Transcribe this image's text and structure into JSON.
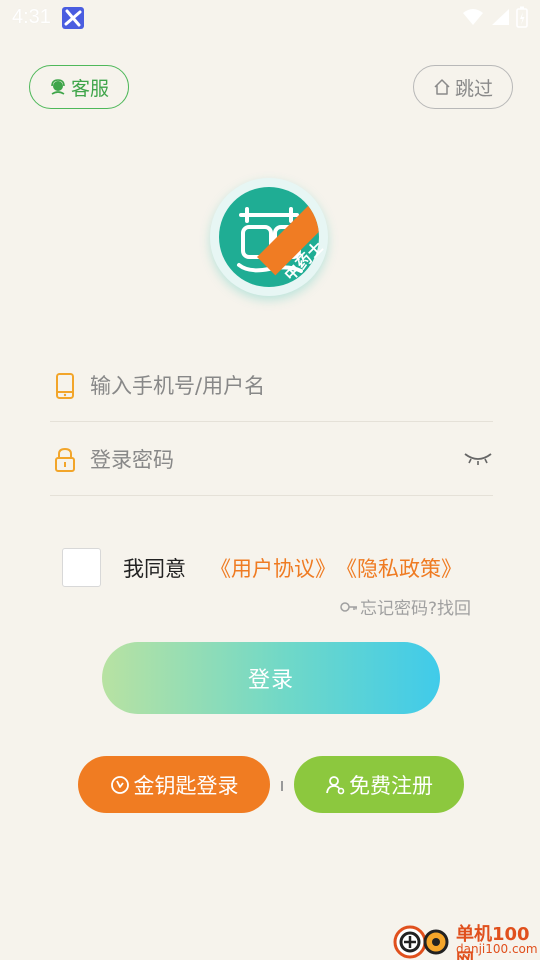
{
  "status_bar": {
    "time": "4:31"
  },
  "header": {
    "service_label": "客服",
    "skip_label": "跳过"
  },
  "logo": {
    "badge_text": "中药士"
  },
  "form": {
    "phone_placeholder": "输入手机号/用户名",
    "password_placeholder": "登录密码"
  },
  "agreement": {
    "agree_label": "我同意",
    "user_agreement": "《用户协议》",
    "privacy_policy": "《隐私政策》",
    "forgot_label": "忘记密码?找回"
  },
  "actions": {
    "login_label": "登录",
    "golden_key_label": "金钥匙登录",
    "register_label": "免费注册"
  },
  "watermark": {
    "cn": "单机100网",
    "en": "danji100.com"
  },
  "colors": {
    "background": "#f6f3ec",
    "service_green": "#4fb85a",
    "brand_teal": "#1fad94",
    "accent_orange": "#f07c22",
    "register_green": "#8cc83e",
    "login_gradient_start": "#b8e2a2",
    "login_gradient_end": "#40cbea"
  }
}
